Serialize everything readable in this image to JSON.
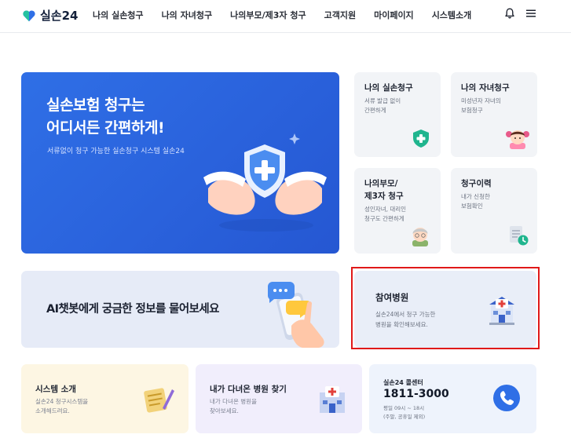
{
  "header": {
    "logo_text": "실손24",
    "nav": [
      "나의 실손청구",
      "나의 자녀청구",
      "나의부모/제3자 청구",
      "고객지원",
      "마이페이지",
      "시스템소개"
    ]
  },
  "hero": {
    "title_line1": "실손보험 청구는",
    "title_line2": "어디서든 간편하게!",
    "subtitle": "서류없이 청구 가능한 실손청구 시스템 실손24"
  },
  "cards": {
    "my_claim": {
      "title": "나의 실손청구",
      "desc1": "서류 발급 없이",
      "desc2": "간편하게"
    },
    "child_claim": {
      "title": "나의 자녀청구",
      "desc1": "미성년자 자녀의",
      "desc2": "보험청구"
    },
    "parent_claim": {
      "title_line1": "나의부모/",
      "title_line2": "제3자 청구",
      "desc1": "성인자녀, 대리인",
      "desc2": "청구도 간편하게"
    },
    "history": {
      "title": "청구이력",
      "desc1": "내가 신청한",
      "desc2": "보험확인"
    }
  },
  "ai_banner": {
    "text": "AI챗봇에게 궁금한 정보를 물어보세요"
  },
  "hospital": {
    "title": "참여병원",
    "desc1": "실손24에서 청구 가능한",
    "desc2": "병원을 확인해보세요."
  },
  "bottom": {
    "system": {
      "title": "시스템 소개",
      "desc1": "실손24 청구시스템을",
      "desc2": "소개해드려요."
    },
    "find_hospital": {
      "title": "내가 다녀온 병원 찾기",
      "desc1": "내가 다녀온 병원을",
      "desc2": "찾아보세요."
    },
    "call_center": {
      "label": "실손24 콜센터",
      "phone": "1811-3000",
      "hours1": "평일 09시 ~ 18시",
      "hours2": "(주말, 공휴일 제외)"
    }
  },
  "colors": {
    "brand_blue": "#2c66e0",
    "highlight_red": "#e01919",
    "phone_blue": "#2f6fe6",
    "system_bg": "#fdf6e3",
    "find_bg": "#f1eefc",
    "call_bg": "#eef3fc"
  },
  "icons": [
    "heart-logo-icon",
    "bell-icon",
    "menu-icon",
    "shield-plus-icon",
    "child-face-icon",
    "grandparent-face-icon",
    "document-clock-icon",
    "hospital-building-icon",
    "chat-phone-icon",
    "notepad-pencil-icon",
    "hospital-icon",
    "phone-icon"
  ]
}
